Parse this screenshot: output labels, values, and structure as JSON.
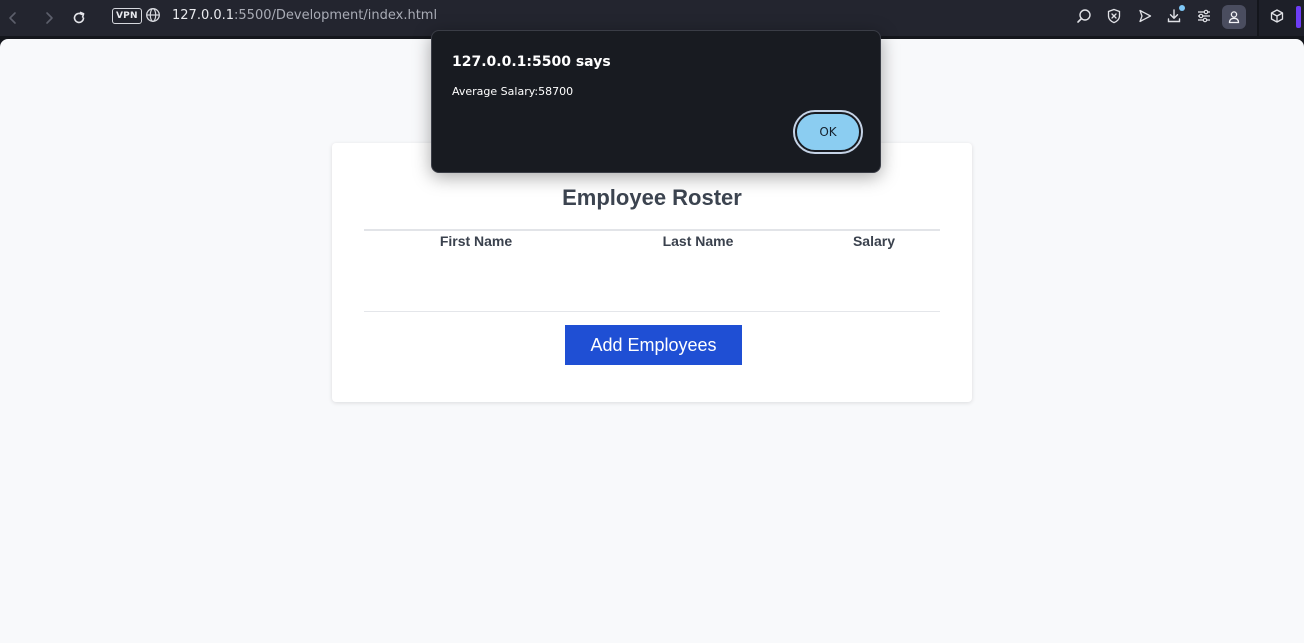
{
  "browser": {
    "vpn_label": "VPN",
    "url_host": "127.0.0.1",
    "url_rest": ":5500/Development/index.html"
  },
  "page": {
    "title": "Employee Roster",
    "columns": [
      "First Name",
      "Last Name",
      "Salary"
    ],
    "add_button": "Add Employees"
  },
  "dialog": {
    "title": "127.0.0.1:5500 says",
    "message": "Average Salary:58700",
    "ok_label": "OK"
  },
  "colors": {
    "add_button": "#1f4fd4",
    "ok_button": "#8bcdf1",
    "dialog_bg": "#181b21",
    "page_bg": "#f8f9fb"
  }
}
